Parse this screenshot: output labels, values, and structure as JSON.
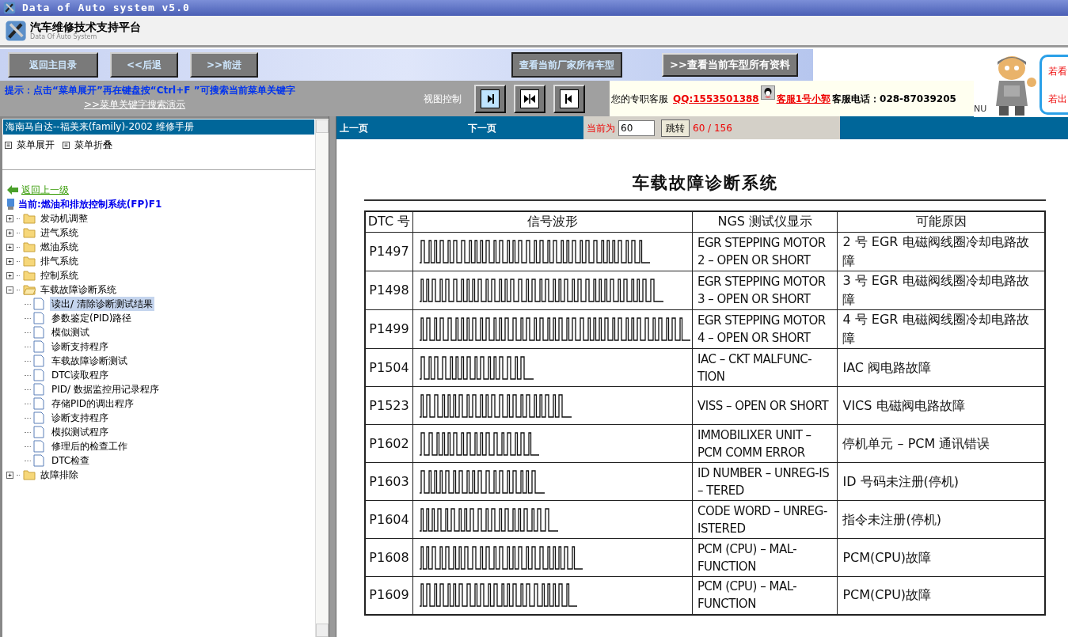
{
  "window": {
    "title": "Data of Auto system v5.0"
  },
  "header": {
    "title": "汽车维修技术支持平台",
    "subtitle": "Data Of Auto System"
  },
  "toolbar": {
    "buttons": [
      "返回主目录",
      "<<后退",
      ">>前进"
    ],
    "make_button": "查看当前厂家所有车型",
    "model_button": ">>查看当前车型所有资料"
  },
  "hint": {
    "text": "提示：点击“菜单展开”再在键盘按“Ctrl+F ”可搜索当前菜单关键字",
    "link": ">>菜单关键字搜索演示"
  },
  "view_control": {
    "label": "视图控制",
    "buttons": [
      {
        "kind": "right",
        "selected": true
      },
      {
        "kind": "both",
        "selected": false
      },
      {
        "kind": "left",
        "selected": false
      }
    ]
  },
  "support": {
    "label": "您的专职客服",
    "qq": "QQ:1553501388",
    "agent": "客服1号小郭",
    "phone": "客服电话：028-87039205"
  },
  "ad": {
    "cut_text": "NU",
    "lines": [
      "若看",
      "若出"
    ]
  },
  "sidebar": {
    "title": "海南马自达--福美来(family)-2002 维修手册",
    "actions": [
      "菜单展开",
      "菜单折叠"
    ],
    "back_link": "返回上一级",
    "current": "当前:燃油和排放控制系统(FP)F1",
    "tree": [
      {
        "label": "发动机调整",
        "kind": "folder",
        "expanded": false,
        "selected": false
      },
      {
        "label": "进气系统",
        "kind": "folder",
        "expanded": false,
        "selected": false
      },
      {
        "label": "燃油系统",
        "kind": "folder",
        "expanded": false,
        "selected": false
      },
      {
        "label": "排气系统",
        "kind": "folder",
        "expanded": false,
        "selected": false
      },
      {
        "label": "控制系统",
        "kind": "folder",
        "expanded": false,
        "selected": false
      },
      {
        "label": "车载故障诊断系统",
        "kind": "folder",
        "expanded": true,
        "selected": false,
        "children": [
          {
            "label": "读出/ 清除诊断测试结果",
            "selected": true
          },
          {
            "label": "参数鉴定(PID)路径",
            "selected": false
          },
          {
            "label": "模似测试",
            "selected": false
          },
          {
            "label": "诊断支持程序",
            "selected": false
          },
          {
            "label": "车载故障诊断测试",
            "selected": false
          },
          {
            "label": "DTC读取程序",
            "selected": false
          },
          {
            "label": "PID/ 数据监控用记录程序",
            "selected": false
          },
          {
            "label": "存储PID的调出程序",
            "selected": false
          },
          {
            "label": "诊断支持程序",
            "selected": false
          },
          {
            "label": "模拟测试程序",
            "selected": false
          },
          {
            "label": "修理后的检查工作",
            "selected": false
          },
          {
            "label": "DTC检查",
            "selected": false
          }
        ]
      },
      {
        "label": "故障排除",
        "kind": "folder",
        "expanded": false,
        "selected": false
      }
    ]
  },
  "pager": {
    "prev": "上一页",
    "next": "下一页",
    "current_label": "当前为",
    "page_value": "60",
    "go_button": "跳转",
    "count": "60 / 156"
  },
  "document": {
    "title": "车载故障诊断系统",
    "columns": [
      "DTC 号",
      "信号波形",
      "NGS 测试仪显示",
      "可能原因"
    ],
    "rows": [
      {
        "code": "P1497",
        "display": "EGR STEPPING MOTOR 2 – OPEN OR SHORT",
        "cause": "2 号 EGR 电磁阀线圈冷却电路故障"
      },
      {
        "code": "P1498",
        "display": "EGR STEPPING MOTOR 3 – OPEN OR SHORT",
        "cause": "3 号 EGR 电磁阀线圈冷却电路故障"
      },
      {
        "code": "P1499",
        "display": "EGR STEPPING MOTOR 4 – OPEN OR SHORT",
        "cause": "4 号 EGR 电磁阀线圈冷却电路故障"
      },
      {
        "code": "P1504",
        "display": "IAC – CKT MALFUNC-TION",
        "cause": "IAC 阀电路故障"
      },
      {
        "code": "P1523",
        "display": "VISS – OPEN OR SHORT",
        "cause": "VICS 电磁阀电路故障"
      },
      {
        "code": "P1602",
        "display": "IMMOBILIXER UNIT – PCM COMM ERROR",
        "cause": "停机单元 – PCM 通讯错误"
      },
      {
        "code": "P1603",
        "display": "ID NUMBER – UNREG-IS – TERED",
        "cause": "ID 号码未注册(停机)"
      },
      {
        "code": "P1604",
        "display": "CODE WORD – UNREG-ISTERED",
        "cause": "指令未注册(停机)"
      },
      {
        "code": "P1608",
        "display": "PCM (CPU) – MAL-FUNCTION",
        "cause": "PCM(CPU)故障"
      },
      {
        "code": "P1609",
        "display": "PCM (CPU) – MAL-FUNCTION",
        "cause": "PCM(CPU)故障"
      }
    ]
  }
}
